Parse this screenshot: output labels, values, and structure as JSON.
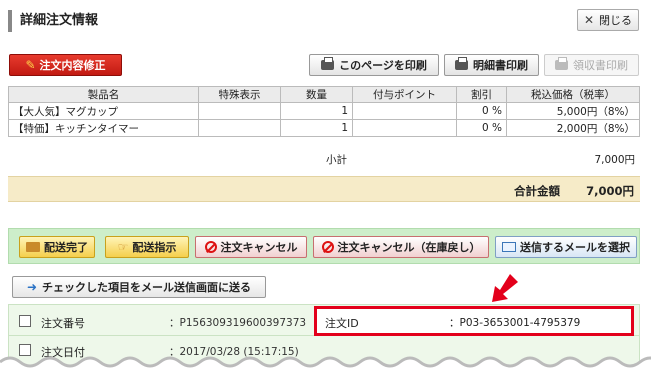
{
  "header": {
    "title": "詳細注文情報",
    "close_label": "閉じる"
  },
  "toolbar": {
    "edit_label": "注文内容修正",
    "print_page_label": "このページを印刷",
    "print_statement_label": "明細書印刷",
    "print_receipt_label": "領収書印刷"
  },
  "table": {
    "headers": [
      "製品名",
      "特殊表示",
      "数量",
      "付与ポイント",
      "割引",
      "税込価格（税率）"
    ],
    "rows": [
      {
        "name": "【大人気】マグカップ",
        "special": "",
        "qty": "1",
        "points": "",
        "discount": "0 %",
        "price": "5,000円（8%）"
      },
      {
        "name": "【特価】キッチンタイマー",
        "special": "",
        "qty": "1",
        "points": "",
        "discount": "0 %",
        "price": "2,000円（8%）"
      }
    ]
  },
  "summary": {
    "subtotal_label": "小計",
    "subtotal_value": "7,000円",
    "total_label": "合計金額",
    "total_value": "7,000円"
  },
  "actions": {
    "ship_done": "配送完了",
    "ship_instruct": "配送指示",
    "cancel": "注文キャンセル",
    "cancel_restock": "注文キャンセル（在庫戻し）",
    "select_mail": "送信するメールを選択"
  },
  "send_checked_label": "チェックした項目をメール送信画面に送る",
  "details": {
    "order_number_label": "注文番号",
    "order_number_value": "：P156309319600397373",
    "order_id_label": "注文ID",
    "order_id_value": "：P03-3653001-4795379",
    "order_date_label": "注文日付",
    "order_date_value": "：2017/03/28 (15:17:15)"
  },
  "colors": {
    "accent_red": "#e3001b",
    "total_bg": "#f6ebc8",
    "action_bg": "#cdeeca"
  }
}
